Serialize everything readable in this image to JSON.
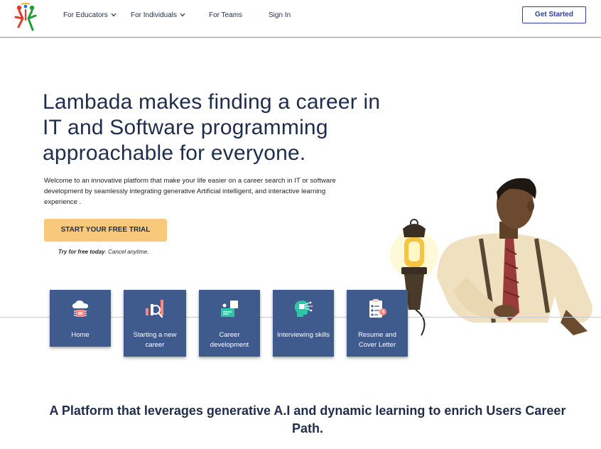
{
  "nav": {
    "items": [
      {
        "label": "For Educators",
        "dropdown": true
      },
      {
        "label": "For Individuals",
        "dropdown": true
      },
      {
        "label": "For Teams",
        "dropdown": false
      },
      {
        "label": "Sign In",
        "dropdown": false
      }
    ],
    "cta_label": "Get Started"
  },
  "hero": {
    "title": "Lambada makes finding a career in IT and Software programming approachable for everyone.",
    "description": "Welcome to an innovative platform that  make your life easier on a career search in IT or software development by seamlessly integrating generative Artificial intelligent, and interactive learning experience .",
    "cta_label": "START YOUR FREE TRIAL",
    "note_bold": "Try for free today",
    "note_rest": ". Cancel anytime."
  },
  "cards": [
    {
      "label": "Home",
      "icon": "cloud-chip-icon"
    },
    {
      "label": "Starting a new career",
      "icon": "chart-search-icon"
    },
    {
      "label": "Career development",
      "icon": "presentation-board-icon"
    },
    {
      "label": "Interviewing skills",
      "icon": "head-circuit-icon"
    },
    {
      "label": "Resume and Cover Letter",
      "icon": "checklist-icon"
    }
  ],
  "tagline": "A Platform that leverages generative A.I and dynamic learning to enrich Users Career Path.",
  "colors": {
    "primary_text": "#1f2d4d",
    "accent_blue": "#2b3ea1",
    "card_bg": "#3f5a8c",
    "cta_bg": "#f8c97a"
  }
}
